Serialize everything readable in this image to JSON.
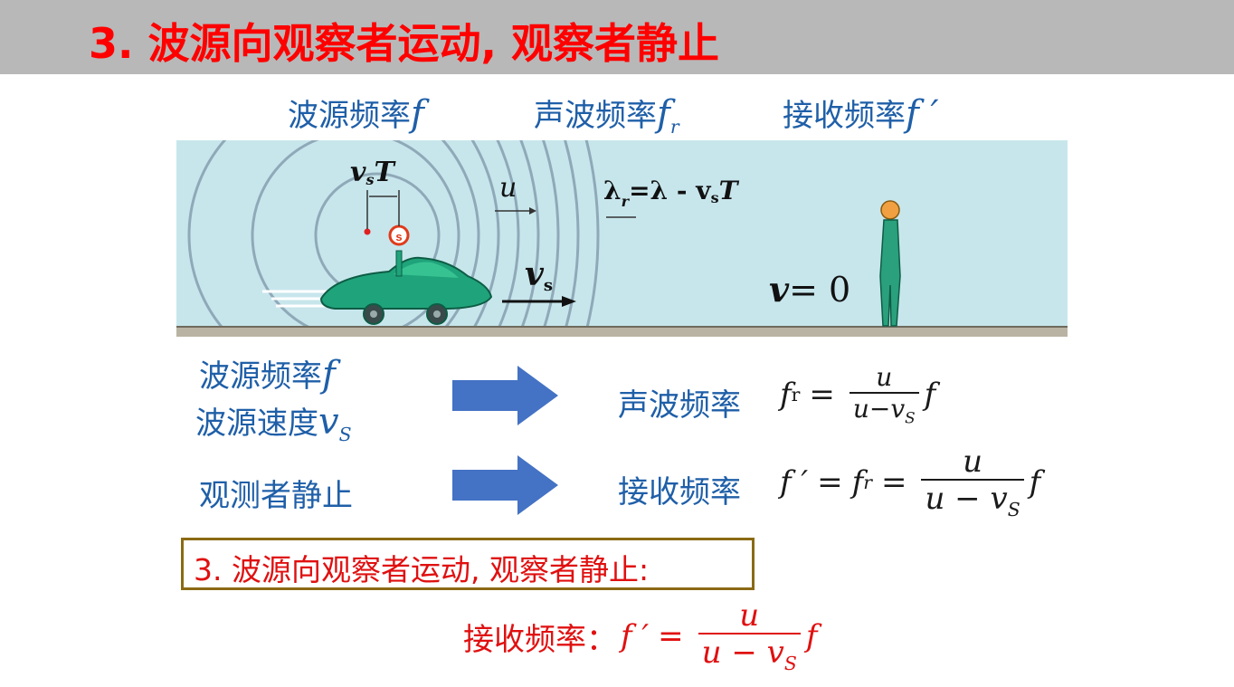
{
  "title": "3. 波源向观察者运动, 观察者静止",
  "top_labels": {
    "source_freq": "波源频率",
    "source_freq_sym": "f",
    "wave_freq": "声波频率",
    "wave_freq_sym": "f",
    "wave_freq_sub": "r",
    "recv_freq": "接收频率",
    "recv_freq_sym": "f ′"
  },
  "diagram": {
    "vsT": "v",
    "vsT_sub": "s",
    "vsT_T": "T",
    "u": "u",
    "lambda_eq": "λ",
    "lambda_sub": "r",
    "lambda_rhs": "=λ - v",
    "lambda_rhs_sub": "s",
    "lambda_rhs_T": "T",
    "s_marker": "s",
    "vs": "v",
    "vs_sub": "s",
    "v0": "v",
    "v0_rhs": "= 0",
    "colors": {
      "sky": "#c7e6ec",
      "wave": "#8fa9b8",
      "car": "#1fa37a",
      "ground": "#8a8a7a",
      "person": "#2aa07c"
    }
  },
  "row1": {
    "left1": "波源频率",
    "left1_sym": "f",
    "left2": "波源速度",
    "left2_sym": "v",
    "left2_sub": "S",
    "right_label": "声波频率",
    "f": "f",
    "f_sub": "r",
    "eq": "=",
    "num": "u",
    "den": "u−v",
    "den_sub": "S",
    "tail": "f"
  },
  "row2": {
    "left": "观测者静止",
    "right_label": "接收频率",
    "f": "f ′",
    "eq1": "=",
    "fr": "f",
    "fr_sub": "r",
    "eq2": "=",
    "num": "u",
    "den": "u − v",
    "den_sub": "S",
    "tail": "f"
  },
  "box_text": "3. 波源向观察者运动, 观察者静止:",
  "final": {
    "label": "接收频率：",
    "f": "f ′",
    "eq": "=",
    "num": "u",
    "den": "u − v",
    "den_sub": "S",
    "tail": "f"
  },
  "accent_colors": {
    "title": "#ff0000",
    "blue_text": "#1f5fa8",
    "arrow": "#4472c4",
    "box_border": "#8b6a14",
    "red_text": "#e01010"
  }
}
